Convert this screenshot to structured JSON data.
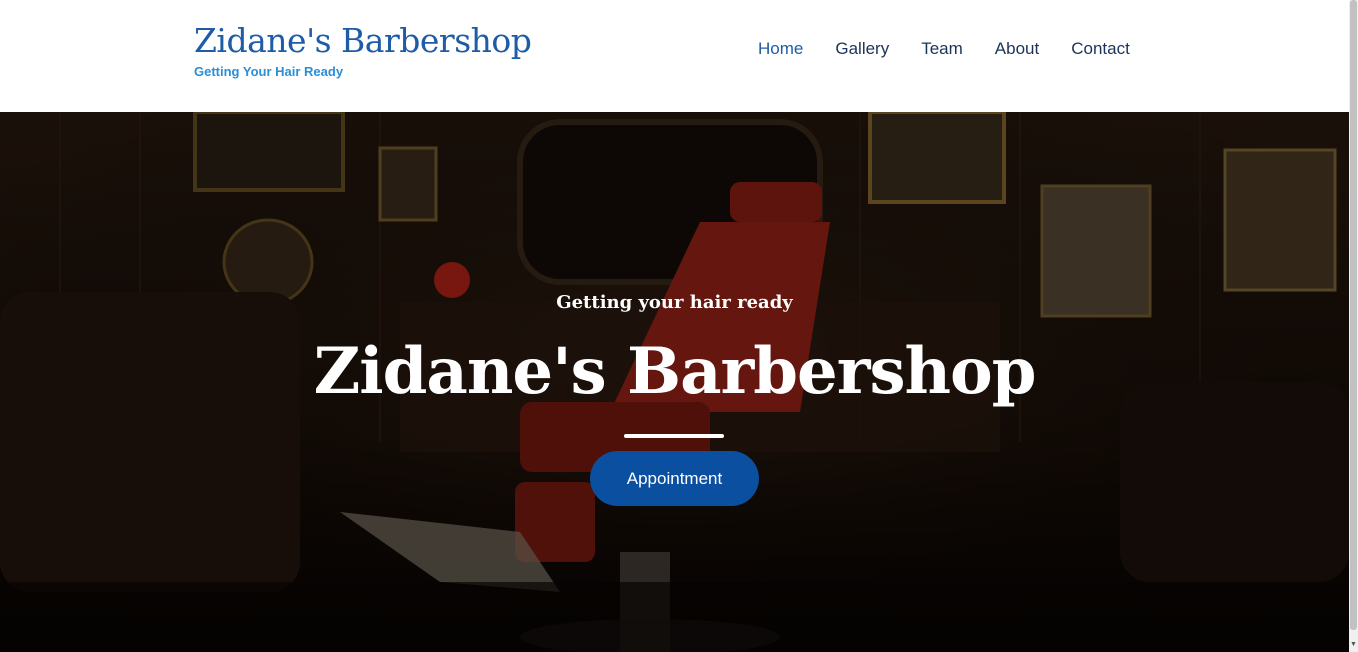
{
  "header": {
    "brand_title": "Zidane's Barbershop",
    "brand_tagline": "Getting Your Hair Ready"
  },
  "nav": {
    "items": [
      {
        "label": "Home",
        "active": true
      },
      {
        "label": "Gallery",
        "active": false
      },
      {
        "label": "Team",
        "active": false
      },
      {
        "label": "About",
        "active": false
      },
      {
        "label": "Contact",
        "active": false
      }
    ]
  },
  "hero": {
    "subtitle": "Getting your hair ready",
    "title": "Zidane's Barbershop",
    "cta_label": "Appointment"
  },
  "colors": {
    "brand_blue": "#1e5ca8",
    "tagline_blue": "#2a8fd6",
    "nav_text": "#1b3358",
    "button_blue": "#0b4fa0"
  }
}
